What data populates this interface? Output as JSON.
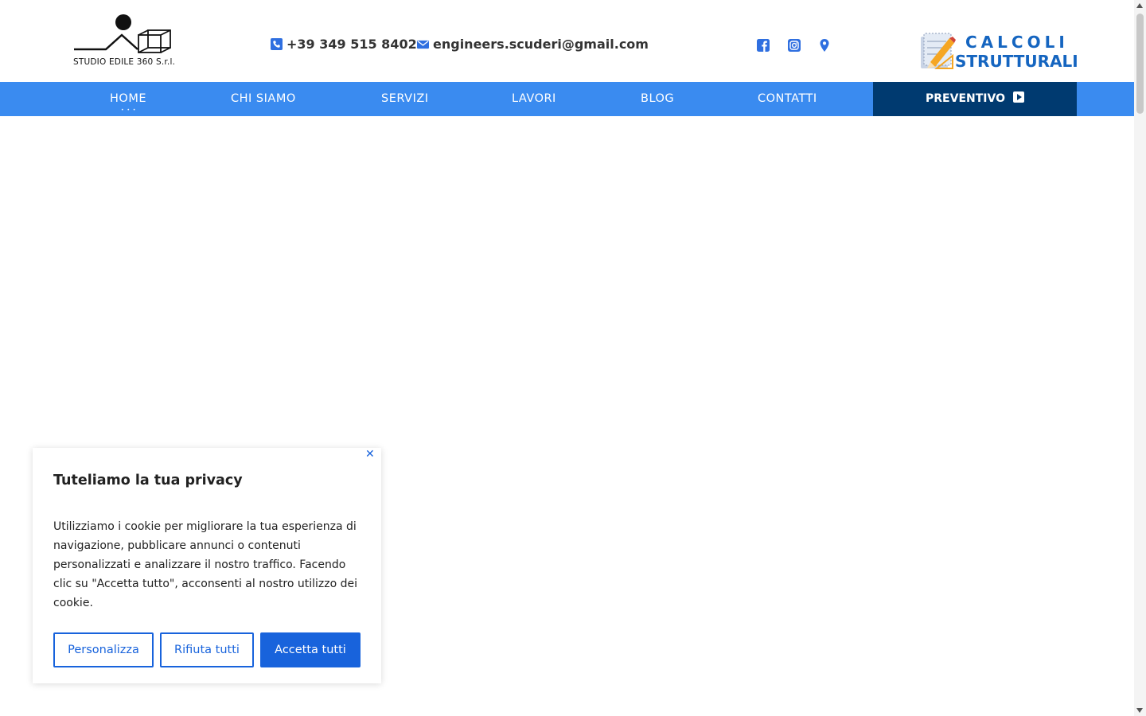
{
  "header": {
    "logo_text": "STUDIO EDILE 360 S.r.l.",
    "phone": "+39 349 515 8402",
    "email": "engineers.scuderi@gmail.com",
    "social_icons": [
      "facebook-icon",
      "instagram-icon",
      "map-marker-icon"
    ],
    "partner_logo": {
      "line1": "CALCOLI",
      "line2": "STRUTTURALI"
    }
  },
  "nav": {
    "items": [
      {
        "label": "HOME",
        "active": true
      },
      {
        "label": "CHI SIAMO"
      },
      {
        "label": "SERVIZI"
      },
      {
        "label": "LAVORI"
      },
      {
        "label": "BLOG"
      },
      {
        "label": "CONTATTI"
      }
    ],
    "cta_label": "PREVENTIVO"
  },
  "cookie_banner": {
    "title": "Tuteliamo la tua privacy",
    "text": "Utilizziamo i cookie per migliorare la tua esperienza di navigazione, pubblicare annunci o contenuti personalizzati e analizzare il nostro traffico. Facendo clic su \"Accetta tutto\", acconsenti al nostro utilizzo dei cookie.",
    "buttons": {
      "customize": "Personalizza",
      "reject": "Rifiuta tutti",
      "accept": "Accetta tutti"
    }
  },
  "colors": {
    "nav_bg": "#3a8bf0",
    "cta_bg": "#003a70",
    "accent": "#1863dc",
    "brand_blue": "#1565c0"
  }
}
